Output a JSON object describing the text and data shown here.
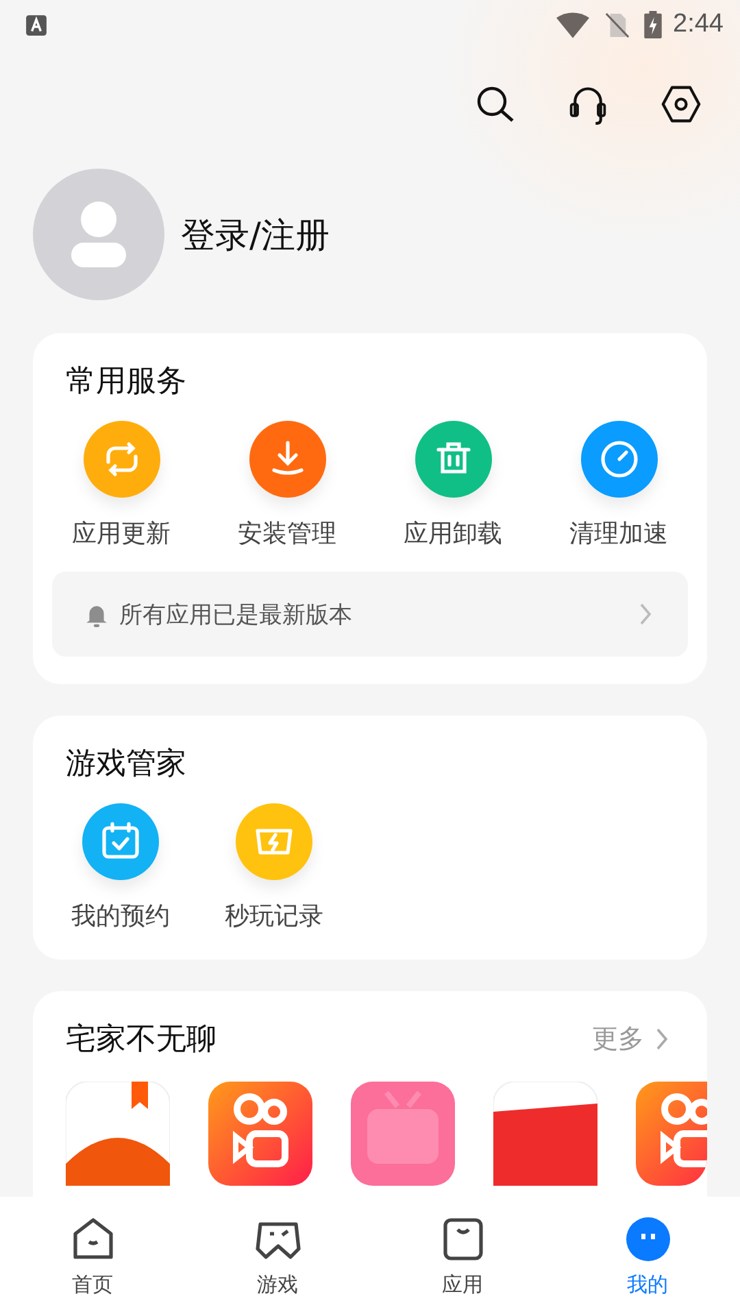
{
  "status_bar": {
    "time": "2:44"
  },
  "profile": {
    "login_label": "登录/注册"
  },
  "services": {
    "title": "常用服务",
    "items": [
      {
        "label": "应用更新",
        "kind": "refresh",
        "color": "#ffad0d"
      },
      {
        "label": "安装管理",
        "kind": "download",
        "color": "#ff6a10"
      },
      {
        "label": "应用卸载",
        "kind": "trash",
        "color": "#10bf86"
      },
      {
        "label": "清理加速",
        "kind": "gauge",
        "color": "#0a9cff"
      }
    ],
    "notice": "所有应用已是最新版本"
  },
  "game_manager": {
    "title": "游戏管家",
    "items": [
      {
        "label": "我的预约",
        "kind": "calendar",
        "color": "#12b2f5"
      },
      {
        "label": "秒玩记录",
        "kind": "gamepad",
        "color": "#ffc20e"
      }
    ]
  },
  "recommend": {
    "title": "宅家不无聊",
    "more": "更多",
    "apps": [
      {
        "kind": "tomato"
      },
      {
        "kind": "camera"
      },
      {
        "kind": "tv"
      },
      {
        "kind": "banner"
      },
      {
        "kind": "camera"
      }
    ]
  },
  "bottom_nav": [
    {
      "label": "首页",
      "kind": "home",
      "selected": false
    },
    {
      "label": "游戏",
      "kind": "game",
      "selected": false
    },
    {
      "label": "应用",
      "kind": "bag",
      "selected": false
    },
    {
      "label": "我的",
      "kind": "face",
      "selected": true
    }
  ]
}
